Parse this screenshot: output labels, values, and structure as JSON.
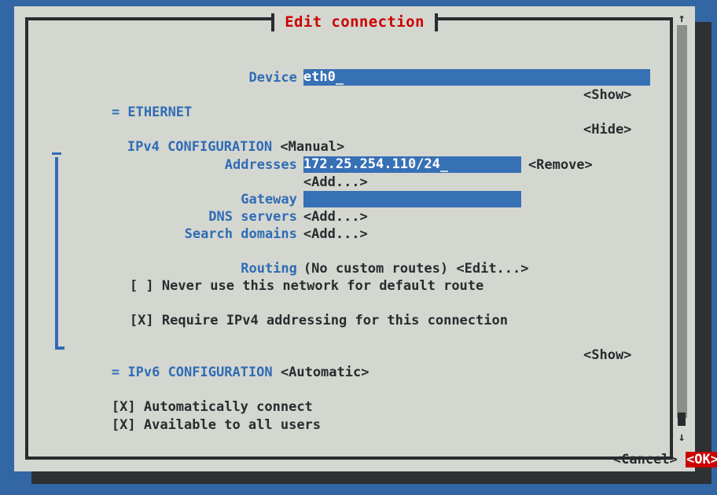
{
  "window": {
    "title": "Edit connection"
  },
  "colors": {
    "desktop": "#3366a4",
    "panel": "#d4d7d0",
    "border": "#282c2e",
    "accent_blue": "#3670b5",
    "label_blue": "#2f6cb5",
    "title_red": "#cc0000",
    "ok_red": "#cc0000",
    "shadow": "#2d3134",
    "scroll_thumb": "#8b8f8a"
  },
  "form": {
    "device": {
      "label": "Device",
      "value": "eth0"
    },
    "ethernet": {
      "marker": "=",
      "label": "ETHERNET",
      "action": "<Show>"
    },
    "ipv4": {
      "marker": "=",
      "label": "IPv4 CONFIGURATION",
      "method": "<Manual>",
      "action": "<Hide>",
      "addresses": {
        "label": "Addresses",
        "value": "172.25.254.110/24",
        "remove": "<Remove>",
        "add": "<Add...>"
      },
      "gateway": {
        "label": "Gateway",
        "value": ""
      },
      "dns_servers": {
        "label": "DNS servers",
        "add": "<Add...>"
      },
      "search_domains": {
        "label": "Search domains",
        "add": "<Add...>"
      },
      "routing": {
        "label": "Routing",
        "status": "(No custom routes)",
        "edit": "<Edit...>"
      },
      "never_default": {
        "box": "[ ]",
        "label": "Never use this network for default route"
      },
      "require_ipv4": {
        "box": "[X]",
        "label": "Require IPv4 addressing for this connection"
      }
    },
    "ipv6": {
      "marker": "=",
      "label": "IPv6 CONFIGURATION",
      "method": "<Automatic>",
      "action": "<Show>"
    },
    "auto_connect": {
      "box": "[X]",
      "label": "Automatically connect"
    },
    "all_users": {
      "box": "[X]",
      "label": "Available to all users"
    }
  },
  "buttons": {
    "cancel": "<Cancel>",
    "ok": "<OK>"
  },
  "scrollbar": {
    "up_arrow": "↑",
    "down_arrow": "↓"
  }
}
